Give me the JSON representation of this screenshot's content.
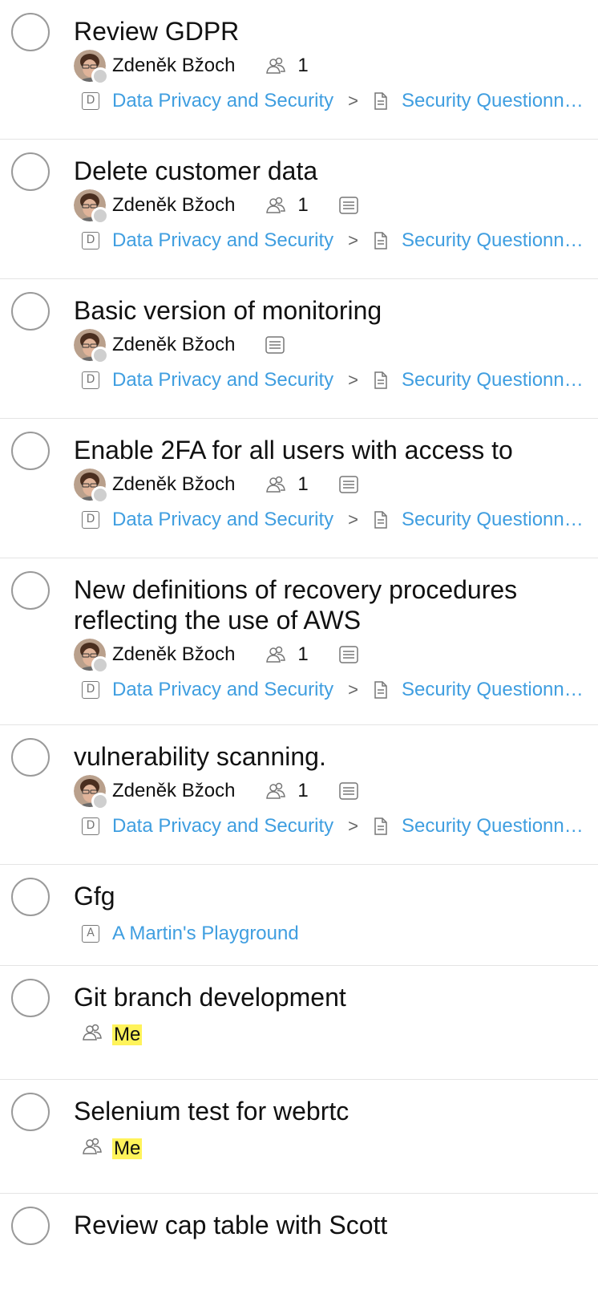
{
  "tasks": [
    {
      "title": "Review GDPR",
      "assignee": "Zdeněk Bžoch",
      "followers": "1",
      "has_note": false,
      "project_badge": "D",
      "project": "Data Privacy and Security",
      "separator": ">",
      "subproject": "Security Questionnaire"
    },
    {
      "title": "Delete customer data",
      "assignee": "Zdeněk Bžoch",
      "followers": "1",
      "has_note": true,
      "project_badge": "D",
      "project": "Data Privacy and Security",
      "separator": ">",
      "subproject": "Security Questionnaire"
    },
    {
      "title": "Basic version of monitoring",
      "assignee": "Zdeněk Bžoch",
      "followers": null,
      "has_note": true,
      "project_badge": "D",
      "project": "Data Privacy and Security",
      "separator": ">",
      "subproject": "Security Questionnaire"
    },
    {
      "title": "Enable 2FA for all users with access to",
      "assignee": "Zdeněk Bžoch",
      "followers": "1",
      "has_note": true,
      "project_badge": "D",
      "project": "Data Privacy and Security",
      "separator": ">",
      "subproject": "Security Questionnaire"
    },
    {
      "title": "New definitions of recovery procedures reflecting the use of AWS",
      "assignee": "Zdeněk Bžoch",
      "followers": "1",
      "has_note": true,
      "project_badge": "D",
      "project": "Data Privacy and Security",
      "separator": ">",
      "subproject": "Security Questionnaire"
    },
    {
      "title": "vulnerability scanning.",
      "assignee": "Zdeněk Bžoch",
      "followers": "1",
      "has_note": true,
      "project_badge": "D",
      "project": "Data Privacy and Security",
      "separator": ">",
      "subproject": "Security Questionnaire"
    },
    {
      "title": "Gfg",
      "project_badge": "A",
      "project": "A Martin's Playground"
    },
    {
      "title": "Git branch development",
      "me_label": "Me"
    },
    {
      "title": "Selenium test for webrtc",
      "me_label": "Me"
    },
    {
      "title": "Review cap table with Scott"
    }
  ],
  "icons": {
    "followers": "followers-icon",
    "note": "note-icon",
    "document": "document-icon",
    "avatar_status": "presence-dot"
  },
  "colors": {
    "link": "#3f9ee0",
    "me_highlight": "#fff35a",
    "checkbox_border": "#9a9a9a",
    "divider": "#e4e4e4"
  }
}
